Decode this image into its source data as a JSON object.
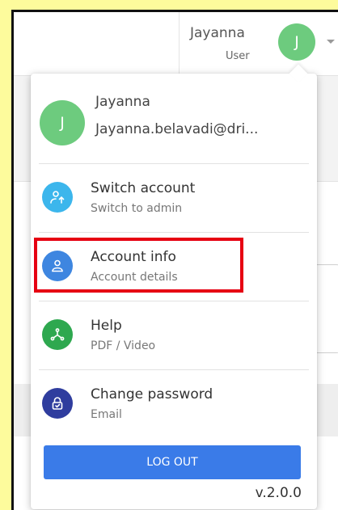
{
  "header": {
    "user_name": "Jayanna",
    "user_role": "User",
    "avatar_initial": "J"
  },
  "menu": {
    "profile": {
      "initial": "J",
      "name": "Jayanna",
      "email": "Jayanna.belavadi@dri..."
    },
    "items": [
      {
        "title": "Switch account",
        "subtitle": "Switch to admin",
        "icon": "switch-account-icon",
        "color": "#3cb6ec"
      },
      {
        "title": "Account info",
        "subtitle": "Account details",
        "icon": "person-icon",
        "color": "#3e86e0",
        "highlighted": true
      },
      {
        "title": "Help",
        "subtitle": "PDF / Video",
        "icon": "share-icon",
        "color": "#2ea84f"
      },
      {
        "title": "Change password",
        "subtitle": "Email",
        "icon": "lock-icon",
        "color": "#2f3d9e"
      }
    ],
    "logout_label": "LOG OUT",
    "version": "v.2.0.0"
  },
  "colors": {
    "background": "#fdfb9c",
    "avatar": "#6dcb7e",
    "accent": "#3a7be8",
    "highlight": "#e60012"
  }
}
